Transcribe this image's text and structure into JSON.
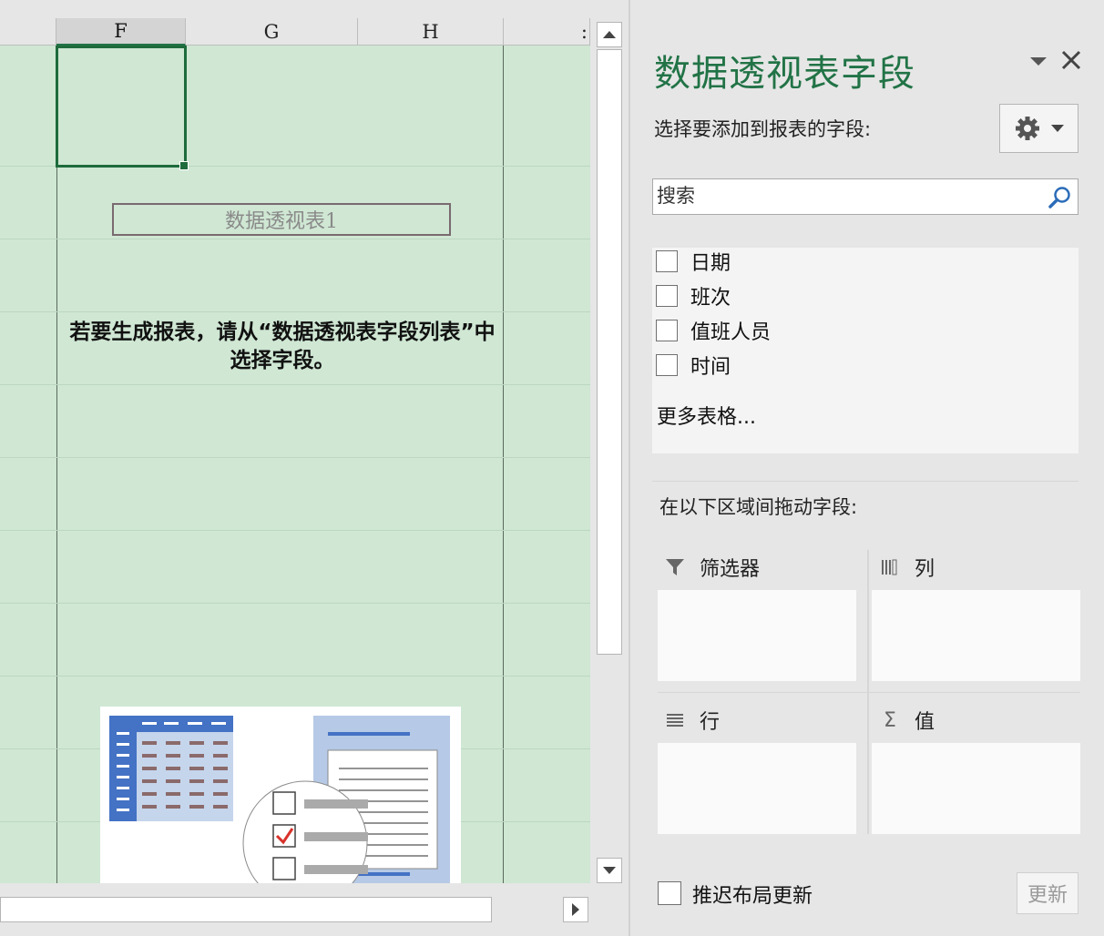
{
  "sheet": {
    "columns": [
      {
        "label": "F",
        "active": true
      },
      {
        "label": "G",
        "active": false
      },
      {
        "label": "H",
        "active": false
      },
      {
        "label": ":",
        "active": false
      }
    ],
    "pivot_table_name": "数据透视表1",
    "instruction": "若要生成报表，请从“数据透视表字段列表”中选择字段。",
    "accent_color": "#217346",
    "background_color": "#cfe7d3"
  },
  "pane": {
    "title": "数据透视表字段",
    "menu_icon": "dropdown-triangle-icon",
    "close_icon": "close-icon",
    "choose_fields_label": "选择要添加到报表的字段:",
    "gear_icon": "gear-icon",
    "search": {
      "value": "",
      "placeholder": "搜索",
      "icon": "search-icon"
    },
    "fields": [
      {
        "label": "日期",
        "checked": false
      },
      {
        "label": "班次",
        "checked": false
      },
      {
        "label": "值班人员",
        "checked": false
      },
      {
        "label": "时间",
        "checked": false
      }
    ],
    "more_tables": "更多表格...",
    "drag_label": "在以下区域间拖动字段:",
    "areas": {
      "filters": {
        "label": "筛选器",
        "icon": "filter-icon"
      },
      "columns": {
        "label": "列",
        "icon": "columns-icon"
      },
      "rows": {
        "label": "行",
        "icon": "rows-icon"
      },
      "values": {
        "label": "值",
        "icon": "sigma-icon"
      }
    },
    "defer_update_label": "推迟布局更新",
    "defer_update_checked": false,
    "update_button": "更新"
  }
}
